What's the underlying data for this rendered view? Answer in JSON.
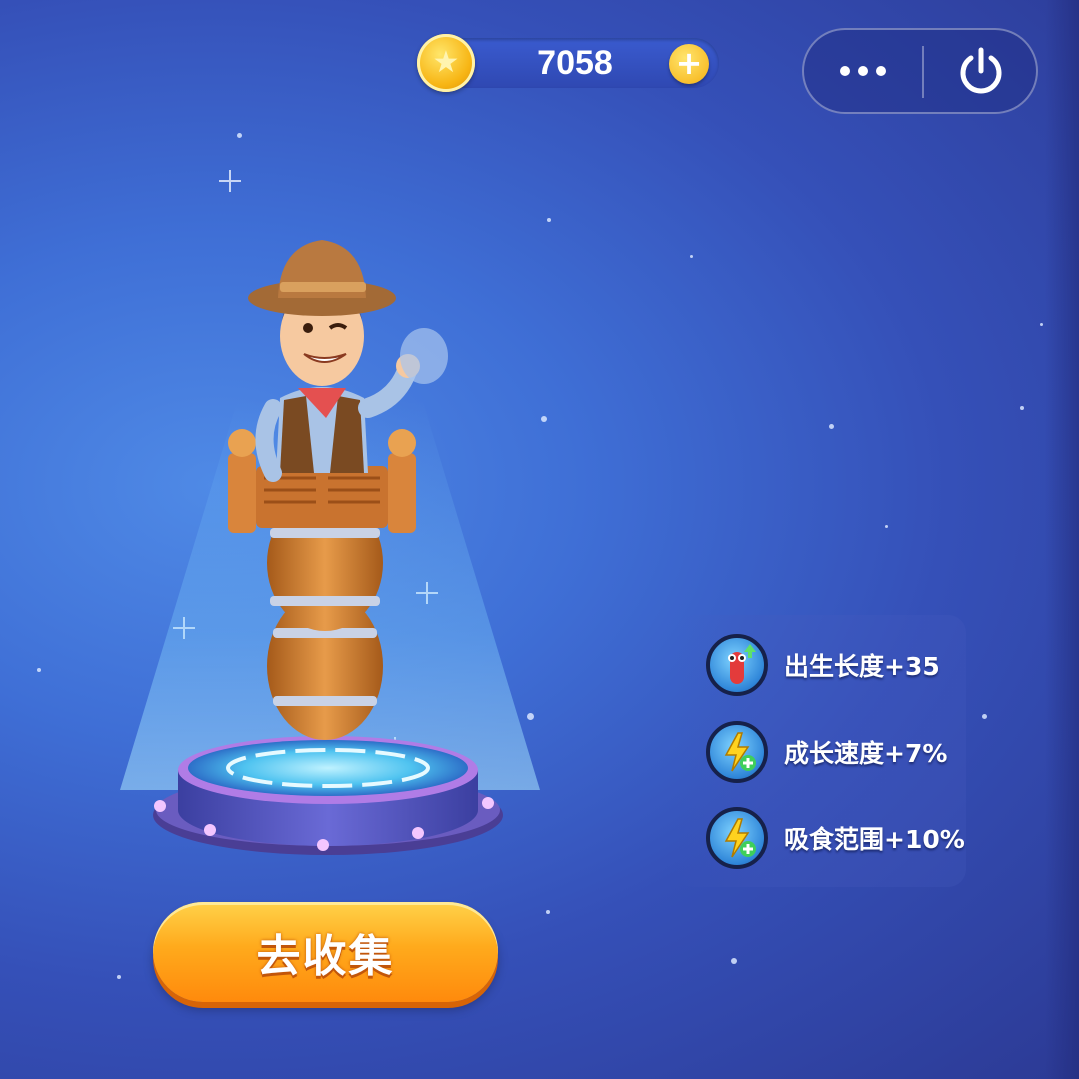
{
  "hud": {
    "coins": "7058",
    "coin_icon": "gold-star-coin-icon",
    "add_icon": "plus-icon"
  },
  "system_capsule": {
    "more_icon": "more-dots-icon",
    "exit_icon": "power-icon"
  },
  "character": {
    "name_icon": "cowboy-in-barrel-skin"
  },
  "actions": {
    "collect_label": "去收集"
  },
  "buffs": [
    {
      "label": "出生长度+35",
      "icon": "worm-length-up-icon"
    },
    {
      "label": "成长速度+7%",
      "icon": "lightning-plus-icon"
    },
    {
      "label": "吸食范围+10%",
      "icon": "lightning-plus-icon"
    }
  ],
  "colors": {
    "background": "#3f6fd6",
    "coin_gold": "#f7b514",
    "button_orange": "#ffaa1c"
  }
}
